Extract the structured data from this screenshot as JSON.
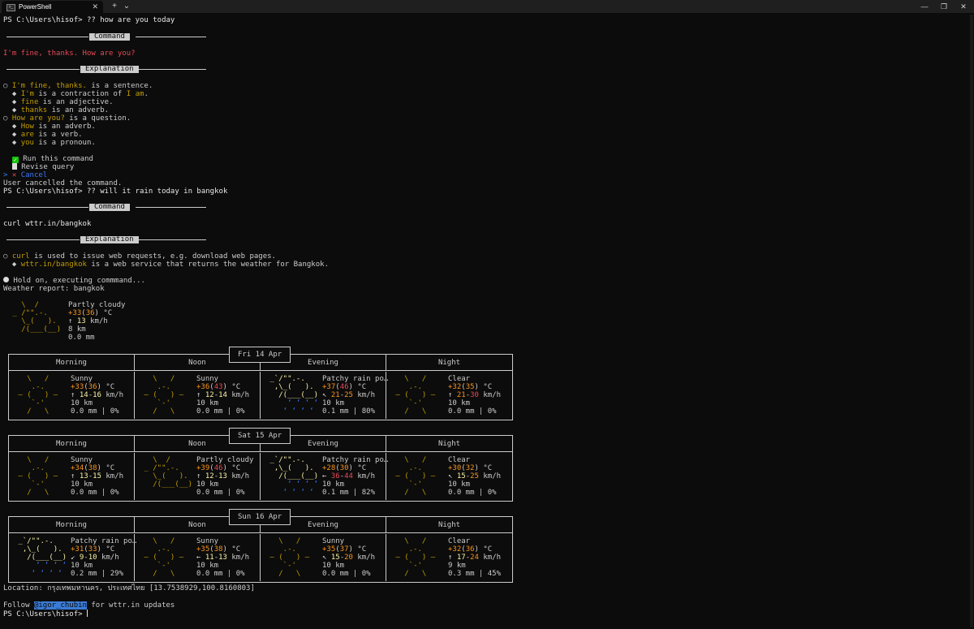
{
  "window": {
    "tab_title": "PowerShell",
    "tab_icon": "powershell-icon",
    "new_tab": "+",
    "dropdown": "⌄",
    "minimize": "—",
    "restore": "❐",
    "close": "✕"
  },
  "session1": {
    "prompt": "PS C:\\Users\\hisof>",
    "command": " ?? how are you today",
    "command_header": "Command",
    "command_text": "I'm fine, thanks. How are you?",
    "explanation_header": "Explanation",
    "explanations": [
      {
        "bullet": "○",
        "hl": "I'm fine, thanks.",
        "rest": " is a sentence.",
        "indent": 0
      },
      {
        "bullet": "◆",
        "hl": "I'm",
        "rest": " is a contraction of ",
        "hl2": "I am",
        "rest2": ".",
        "indent": 1
      },
      {
        "bullet": "◆",
        "hl": "fine",
        "rest": " is an adjective.",
        "indent": 1
      },
      {
        "bullet": "◆",
        "hl": "thanks",
        "rest": " is an adverb.",
        "indent": 1
      },
      {
        "bullet": "○",
        "hl": "How are you?",
        "rest": " is a question.",
        "indent": 0
      },
      {
        "bullet": "◆",
        "hl": "How",
        "rest": " is an adverb.",
        "indent": 1
      },
      {
        "bullet": "◆",
        "hl": "are",
        "rest": " is a verb.",
        "indent": 1
      },
      {
        "bullet": "◆",
        "hl": "you",
        "rest": " is a pronoun.",
        "indent": 1
      }
    ],
    "menu": [
      "Run this command",
      "Revise query",
      "Cancel"
    ],
    "menu_selector": ">",
    "cancelled": "User cancelled the command."
  },
  "session2": {
    "prompt": "PS C:\\Users\\hisof>",
    "command": " ?? will it rain today in bangkok",
    "command_header": "Command",
    "command_text": "curl wttr.in/bangkok",
    "explanation_header": "Explanation",
    "explanations": [
      {
        "bullet": "○",
        "hl": "curl",
        "rest": " is used to issue web requests, e.g. download web pages.",
        "indent": 0
      },
      {
        "bullet": "◆",
        "hl": "wttr.in/bangkok",
        "rest": " is a web service that returns the weather for Bangkok.",
        "indent": 1
      }
    ],
    "executing": " Hold on, executing commmand...",
    "report_title": "Weather report: bangkok"
  },
  "current": {
    "art": [
      "   \\  /      ",
      " _ /\"\".-.    ",
      "   \\_(   ).  ",
      "   /(___(__) ",
      "             "
    ],
    "condition": "Partly cloudy",
    "temp_a": "+33",
    "temp_b": "36",
    "temp_unit": " °C",
    "wind_arrow": "↑",
    "wind_speed": "13",
    "wind_unit": " km/h",
    "visibility": "8 km",
    "precip": "0.0 mm"
  },
  "forecast": {
    "columns": [
      "Morning",
      "Noon",
      "Evening",
      "Night"
    ],
    "days": [
      {
        "label": "Fri 14 Apr",
        "cells": [
          {
            "icon": "sunny",
            "cond": "Sunny",
            "t1": "+33",
            "t2": "36",
            "arrow": "↑",
            "w1": "14",
            "w2": "16",
            "vis": "10 km",
            "rain": "0.0 mm | 0%"
          },
          {
            "icon": "sunny",
            "cond": "Sunny",
            "t1": "+36",
            "t2": "43",
            "arrow": "↑",
            "w1": "12",
            "w2": "14",
            "vis": "10 km",
            "rain": "0.0 mm | 0%"
          },
          {
            "icon": "rain",
            "cond": "Patchy rain po…",
            "t1": "+37",
            "t2": "46",
            "arrow": "↖",
            "w1": "21",
            "w2": "25",
            "vis": "10 km",
            "rain": "0.1 mm | 80%"
          },
          {
            "icon": "clear",
            "cond": "Clear",
            "t1": "+32",
            "t2": "35",
            "arrow": "↑",
            "w1": "21",
            "w2": "30",
            "vis": "10 km",
            "rain": "0.0 mm | 0%"
          }
        ]
      },
      {
        "label": "Sat 15 Apr",
        "cells": [
          {
            "icon": "sunny",
            "cond": "Sunny",
            "t1": "+34",
            "t2": "38",
            "arrow": "↑",
            "w1": "13",
            "w2": "15",
            "vis": "10 km",
            "rain": "0.0 mm | 0%"
          },
          {
            "icon": "cloudy",
            "cond": "Partly cloudy",
            "t1": "+39",
            "t2": "46",
            "arrow": "↑",
            "w1": "12",
            "w2": "13",
            "vis": "10 km",
            "rain": "0.0 mm | 0%"
          },
          {
            "icon": "rain",
            "cond": "Patchy rain po…",
            "t1": "+28",
            "t2": "30",
            "arrow": "←",
            "w1": "36",
            "w2": "44",
            "vis": "10 km",
            "rain": "0.1 mm | 82%"
          },
          {
            "icon": "clear",
            "cond": "Clear",
            "t1": "+30",
            "t2": "32",
            "arrow": "↖",
            "w1": "15",
            "w2": "25",
            "vis": "10 km",
            "rain": "0.0 mm | 0%"
          }
        ]
      },
      {
        "label": "Sun 16 Apr",
        "cells": [
          {
            "icon": "rain",
            "cond": "Patchy rain po…",
            "t1": "+31",
            "t2": "33",
            "arrow": "↙",
            "w1": "9",
            "w2": "10",
            "vis": "10 km",
            "rain": "0.2 mm | 29%"
          },
          {
            "icon": "sunny",
            "cond": "Sunny",
            "t1": "+35",
            "t2": "38",
            "arrow": "←",
            "w1": "11",
            "w2": "13",
            "vis": "10 km",
            "rain": "0.0 mm | 0%"
          },
          {
            "icon": "sunny",
            "cond": "Sunny",
            "t1": "+35",
            "t2": "37",
            "arrow": "↖",
            "w1": "15",
            "w2": "20",
            "vis": "10 km",
            "rain": "0.0 mm | 0%"
          },
          {
            "icon": "clear",
            "cond": "Clear",
            "t1": "+32",
            "t2": "36",
            "arrow": "↑",
            "w1": "17",
            "w2": "24",
            "vis": "9 km",
            "rain": "0.3 mm | 45%"
          }
        ]
      }
    ],
    "km_h": " km/h",
    "deg_c": " °C"
  },
  "icons": {
    "sunny": [
      "   \\   /    ",
      "    .-.     ",
      " ― (   ) ―  ",
      "    `-'     ",
      "   /   \\    "
    ],
    "clear": [
      "   \\   /    ",
      "    .-.     ",
      " ― (   ) ―  ",
      "    `-'     ",
      "   /   \\    "
    ],
    "cloudy": [
      "   \\  /     ",
      " _ /\"\".-.   ",
      "   \\_(   ). ",
      "   /(___(__)",
      "            "
    ],
    "rain": [
      " _`/\"\".-.   ",
      "  ,\\_(   ). ",
      "   /(___(__)",
      "     ‘ ‘ ‘ ‘",
      "    ‘ ‘ ‘ ‘ "
    ]
  },
  "footer": {
    "location_label": "Location:",
    "location_value": " กรุงเทพมหานคร, ประเทศไทย [13.7538929,100.8160803]",
    "follow_a": "Follow ",
    "follow_link": "@igor_chubin",
    "follow_b": " for wttr.in updates",
    "prompt": "PS C:\\Users\\hisof>"
  }
}
